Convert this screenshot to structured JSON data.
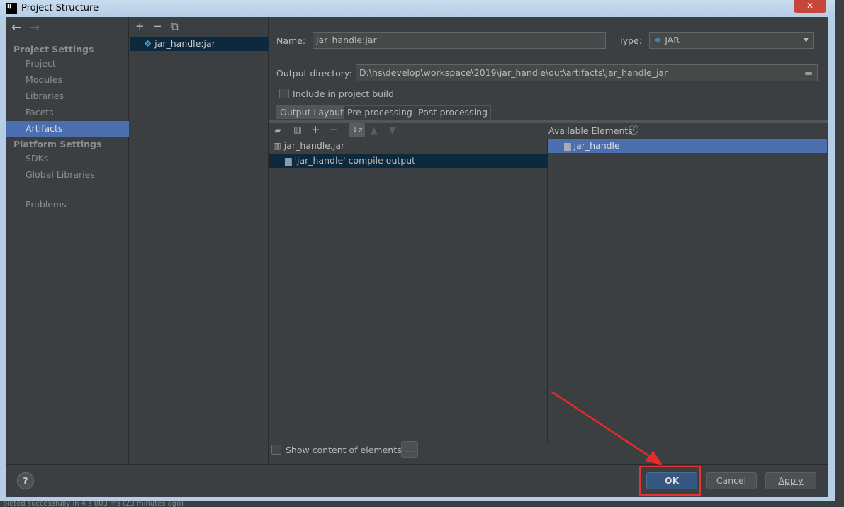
{
  "window": {
    "title": "Project Structure",
    "close_glyph": "✕"
  },
  "nav": {
    "back": "←",
    "forward": "→"
  },
  "sidebar": {
    "sections": [
      {
        "label": "Project Settings",
        "items": [
          "Project",
          "Modules",
          "Libraries",
          "Facets",
          "Artifacts"
        ]
      },
      {
        "label": "Platform Settings",
        "items": [
          "SDKs",
          "Global Libraries"
        ]
      }
    ],
    "problems": "Problems",
    "selected": "Artifacts"
  },
  "artifacts": {
    "toolbar": {
      "add": "+",
      "remove": "−",
      "copy": "⧉"
    },
    "items": [
      {
        "label": "jar_handle:jar",
        "icon": "artifact-diamond-icon"
      }
    ]
  },
  "form": {
    "name_label": "Name:",
    "name_value": "jar_handle:jar",
    "type_label": "Type:",
    "type_value": "JAR",
    "output_dir_label": "Output directory:",
    "output_dir_value": "D:\\hs\\develop\\workspace\\2019\\jar_handle\\out\\artifacts\\jar_handle_jar",
    "include_label": "Include in project build",
    "include_checked": false
  },
  "tabs": [
    "Output Layout",
    "Pre-processing",
    "Post-processing"
  ],
  "selected_tab": "Output Layout",
  "layout": {
    "tree": [
      {
        "label": "jar_handle.jar",
        "icon": "jar-icon"
      },
      {
        "label": "'jar_handle' compile output",
        "icon": "folder-icon",
        "selected": true
      }
    ],
    "available_label": "Available Elements",
    "available": [
      {
        "label": "jar_handle",
        "icon": "folder-icon",
        "selected": true
      }
    ],
    "show_content_label": "Show content of elements",
    "show_content_checked": false,
    "more": "..."
  },
  "buttons": {
    "help": "?",
    "ok": "OK",
    "cancel": "Cancel",
    "apply": "Apply"
  },
  "status": "pleted successfully in 4 s 803 ms (23 minutes ago)",
  "colors": {
    "selection": "#4b6eaf",
    "accent_ok": "#365880",
    "annotation": "#e23232"
  }
}
